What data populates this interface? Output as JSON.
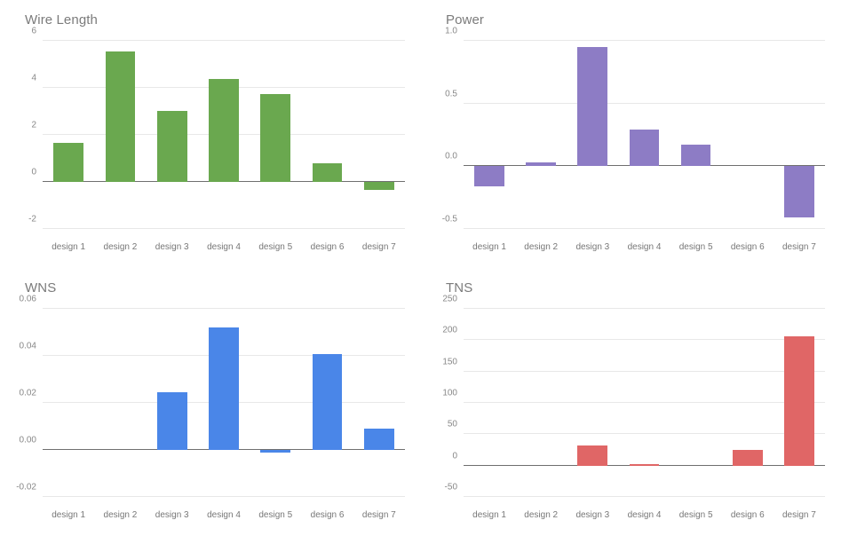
{
  "layout": {
    "columns": 2,
    "rows": 2,
    "panel_order": [
      "wire_length",
      "power",
      "wns",
      "tns"
    ]
  },
  "categories": [
    "design 1",
    "design 2",
    "design 3",
    "design 4",
    "design 5",
    "design 6",
    "design 7"
  ],
  "colors": {
    "wire_length": "#6aa84f",
    "power": "#8d7cc5",
    "wns": "#4a86e8",
    "tns": "#e06666",
    "gridline": "#e8e8e8",
    "zero_axis": "#6f6f6f",
    "title_text": "#7b7b7b",
    "tick_text": "#888888",
    "background": "#ffffff"
  },
  "chart_data": [
    {
      "id": "wire_length",
      "type": "bar",
      "title": "Wire Length",
      "xlabel": "",
      "ylabel": "",
      "grid": true,
      "legend": "none",
      "color": "#6aa84f",
      "categories": [
        "design 1",
        "design 2",
        "design 3",
        "design 4",
        "design 5",
        "design 6",
        "design 7"
      ],
      "values": [
        1.65,
        5.55,
        3.02,
        4.38,
        3.73,
        0.78,
        -0.35
      ],
      "ylim": [
        -2,
        6
      ],
      "yticks": [
        6,
        4,
        2,
        0,
        -2
      ],
      "ytick_labels": [
        "6",
        "4",
        "2",
        "0",
        "-2"
      ]
    },
    {
      "id": "power",
      "type": "bar",
      "title": "Power",
      "xlabel": "",
      "ylabel": "",
      "grid": true,
      "legend": "none",
      "color": "#8d7cc5",
      "categories": [
        "design 1",
        "design 2",
        "design 3",
        "design 4",
        "design 5",
        "design 6",
        "design 7"
      ],
      "values": [
        -0.16,
        0.03,
        0.95,
        0.29,
        0.17,
        0.0,
        -0.41
      ],
      "ylim": [
        -0.5,
        1.0
      ],
      "yticks": [
        1.0,
        0.5,
        0.0,
        -0.5
      ],
      "ytick_labels": [
        "1.0",
        "0.5",
        "0.0",
        "-0.5"
      ]
    },
    {
      "id": "wns",
      "type": "bar",
      "title": "WNS",
      "xlabel": "",
      "ylabel": "",
      "grid": true,
      "legend": "none",
      "color": "#4a86e8",
      "categories": [
        "design 1",
        "design 2",
        "design 3",
        "design 4",
        "design 5",
        "design 6",
        "design 7"
      ],
      "values": [
        0.0,
        0.0,
        0.0244,
        0.0519,
        -0.0013,
        0.0409,
        0.0092
      ],
      "ylim": [
        -0.02,
        0.06
      ],
      "yticks": [
        0.06,
        0.04,
        0.02,
        0.0,
        -0.02
      ],
      "ytick_labels": [
        "0.06",
        "0.04",
        "0.02",
        "0.00",
        "-0.02"
      ]
    },
    {
      "id": "tns",
      "type": "bar",
      "title": "TNS",
      "xlabel": "",
      "ylabel": "",
      "grid": true,
      "legend": "none",
      "color": "#e06666",
      "categories": [
        "design 1",
        "design 2",
        "design 3",
        "design 4",
        "design 5",
        "design 6",
        "design 7"
      ],
      "values": [
        0,
        0,
        32,
        3,
        0,
        25,
        206
      ],
      "ylim": [
        -50,
        250
      ],
      "yticks": [
        250,
        200,
        150,
        100,
        50,
        0,
        -50
      ],
      "ytick_labels": [
        "250",
        "200",
        "150",
        "100",
        "50",
        "0",
        "-50"
      ]
    }
  ]
}
